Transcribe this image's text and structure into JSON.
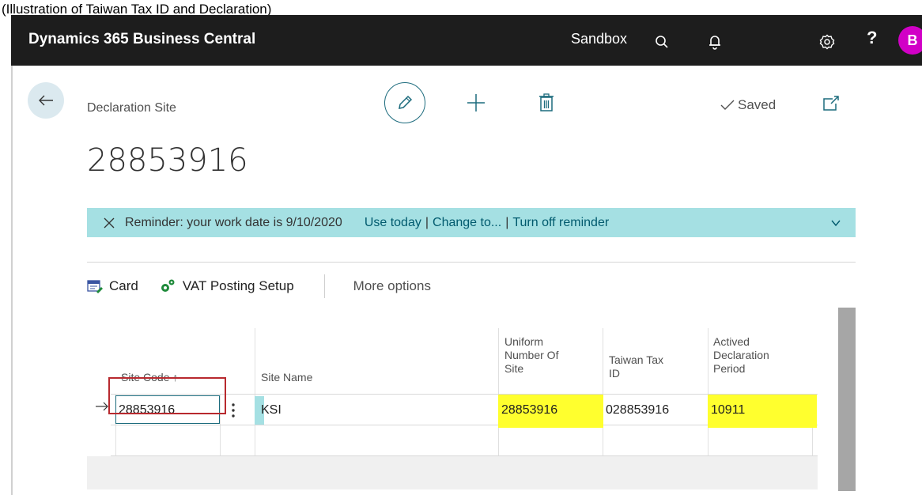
{
  "caption": "(Illustration of Taiwan Tax ID and Declaration)",
  "app_bar": {
    "title": "Dynamics 365 Business Central",
    "environment": "Sandbox",
    "avatar_letter": "B",
    "help_label": "?"
  },
  "page": {
    "caption": "Declaration Site",
    "record_title": "28853916",
    "saved_label": "Saved"
  },
  "reminder": {
    "text": "Reminder: your work date is 9/10/2020",
    "use_today": "Use today",
    "change_to": "Change to...",
    "turn_off": "Turn off reminder",
    "separator": "|"
  },
  "actions": {
    "card": "Card",
    "vat_posting_setup": "VAT Posting Setup",
    "more_options": "More options"
  },
  "table": {
    "columns": {
      "site_code": "Site Code ↑",
      "site_name": "Site Name",
      "uniform_l1": "Uniform",
      "uniform_l2": "Number Of",
      "uniform_l3": "Site",
      "taiwan_l1": "Taiwan Tax",
      "taiwan_l2": "ID",
      "actived_l1": "Actived",
      "actived_l2": "Declaration",
      "actived_l3": "Period"
    },
    "rows": [
      {
        "site_code": "28853916",
        "site_name": "KSI",
        "uniform_number_of_site": "28853916",
        "taiwan_tax_id": "028853916",
        "actived_declaration_period": "10911"
      }
    ]
  },
  "colors": {
    "app_bar": "#1d1d1d",
    "avatar": "#d100c6",
    "reminder_bg": "#a5e0e3",
    "link": "#005a6e",
    "highlight": "#ffff2e",
    "selection_border": "#b8292e",
    "accent": "#1c6b7d"
  }
}
